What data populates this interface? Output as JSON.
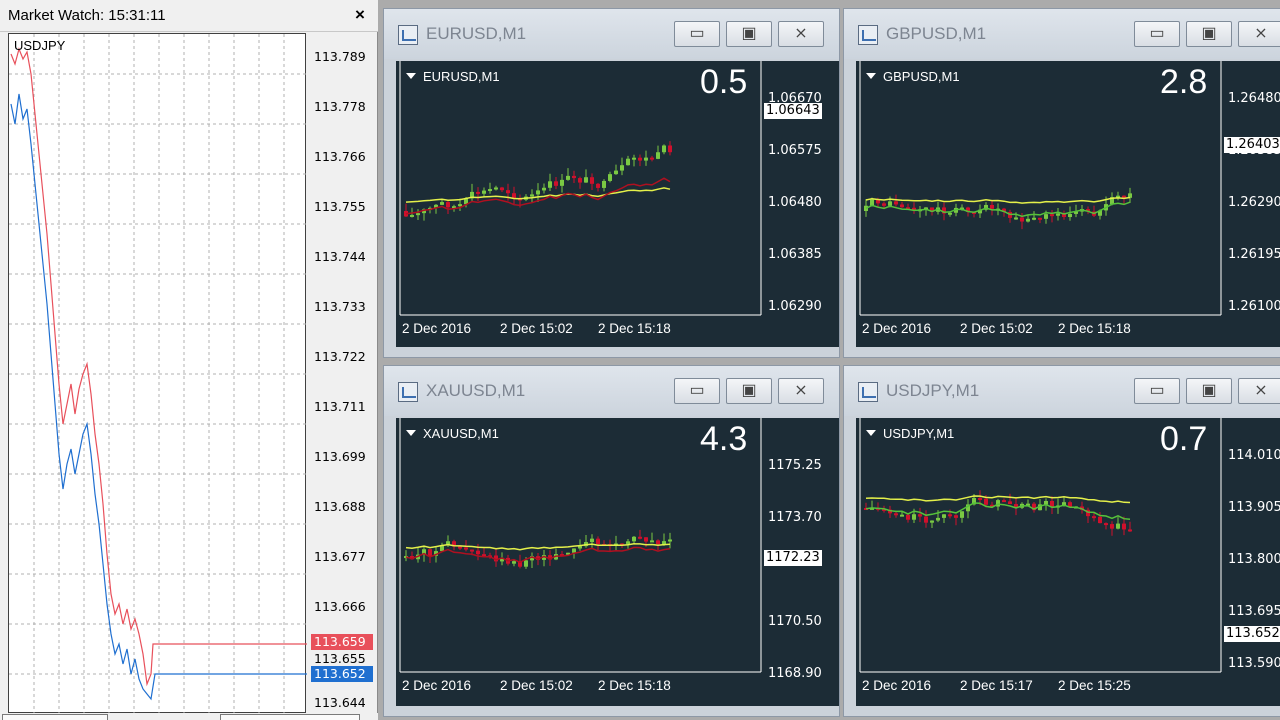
{
  "market_watch": {
    "title": "Market Watch: 15:31:11",
    "close_glyph": "×",
    "symbol": "USDJPY",
    "price_ticks": [
      "113.789",
      "113.778",
      "113.766",
      "113.755",
      "113.744",
      "113.733",
      "113.722",
      "113.711",
      "113.699",
      "113.688",
      "113.677",
      "113.666",
      "113.655",
      "113.644"
    ],
    "ask_tag": "113.659",
    "bid_tag": "113.652",
    "ask_color": "#e8505b",
    "bid_color": "#1f6fd0"
  },
  "windows": [
    {
      "title": "EURUSD,M1",
      "label": "EURUSD,M1",
      "spread": "0.5",
      "price_ticks": [
        "1.06670",
        "1.06575",
        "1.06480",
        "1.06385",
        "1.06290"
      ],
      "price_tag": "1.06643",
      "time_ticks": [
        "2 Dec 2016",
        "2 Dec 15:02",
        "2 Dec 15:18"
      ]
    },
    {
      "title": "GBPUSD,M1",
      "label": "GBPUSD,M1",
      "spread": "2.8",
      "price_ticks": [
        "1.26480",
        "1.26385",
        "1.26290",
        "1.26195",
        "1.26100"
      ],
      "price_tag": "1.26403",
      "time_ticks": [
        "2 Dec 2016",
        "2 Dec 15:02",
        "2 Dec 15:18"
      ]
    },
    {
      "title": "XAUUSD,M1",
      "label": "XAUUSD,M1",
      "spread": "4.3",
      "price_ticks": [
        "1175.25",
        "1173.70",
        "1170.50",
        "1168.90"
      ],
      "price_tag": "1172.23",
      "time_ticks": [
        "2 Dec 2016",
        "2 Dec 15:02",
        "2 Dec 15:18"
      ]
    },
    {
      "title": "USDJPY,M1",
      "label": "USDJPY,M1",
      "spread": "0.7",
      "price_ticks": [
        "114.010",
        "113.905",
        "113.800",
        "113.695",
        "113.590"
      ],
      "price_tag": "113.652",
      "time_ticks": [
        "2 Dec 2016",
        "2 Dec 15:17",
        "2 Dec 15:25"
      ]
    }
  ],
  "window_buttons": {
    "minimize": "▭",
    "restore": "▣",
    "close": "⨯"
  },
  "colors": {
    "chart_bg": "#1c2c36",
    "bull": "#7ac943",
    "bear": "#d0102c",
    "ma_yellow": "#e4f04a",
    "ma_green": "#56c23a",
    "ma_red": "#b01020"
  }
}
